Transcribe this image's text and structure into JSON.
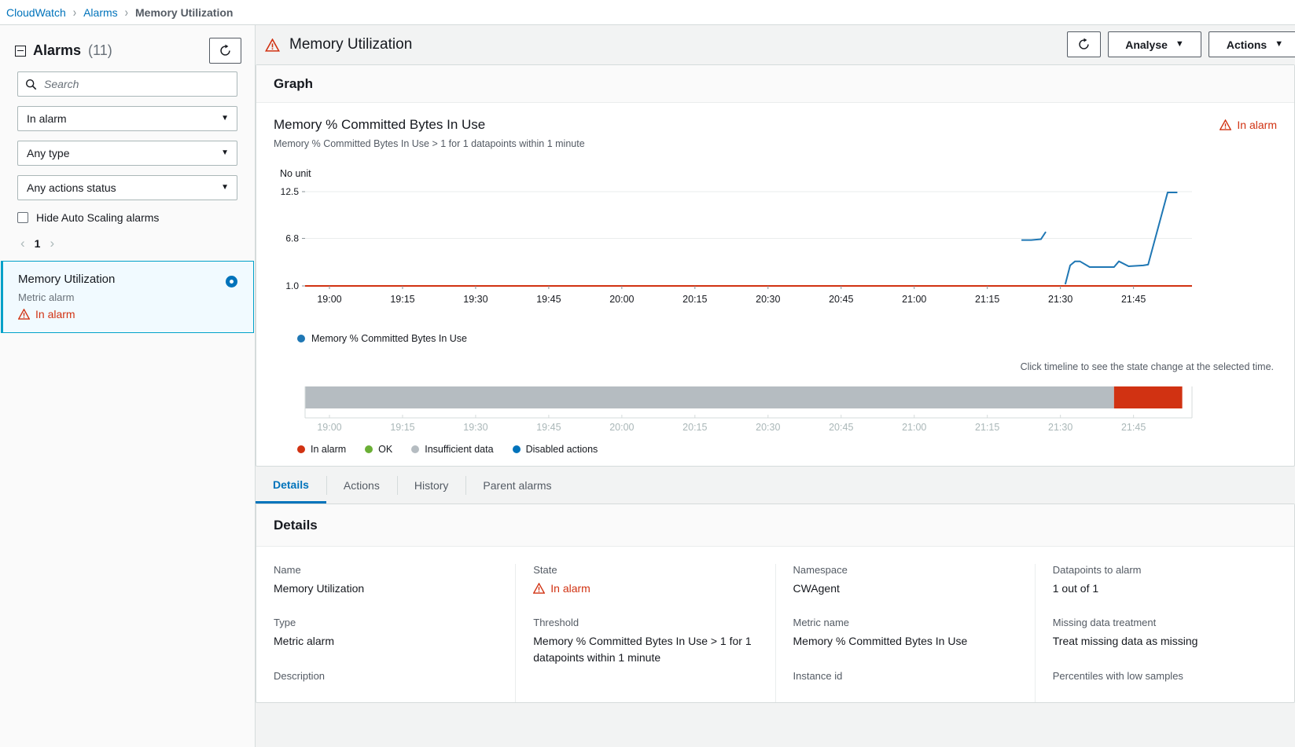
{
  "breadcrumb": {
    "items": [
      {
        "label": "CloudWatch",
        "link": true
      },
      {
        "label": "Alarms",
        "link": true
      },
      {
        "label": "Memory Utilization",
        "link": false
      }
    ],
    "separator": "›"
  },
  "sidebar": {
    "title": "Alarms",
    "count": "(11)",
    "refresh_icon": "refresh-icon",
    "search": {
      "placeholder": "Search",
      "value": "",
      "icon": "search-icon"
    },
    "filters": [
      {
        "name": "state-filter",
        "value": "In alarm"
      },
      {
        "name": "type-filter",
        "value": "Any type"
      },
      {
        "name": "actions-status-filter",
        "value": "Any actions status"
      }
    ],
    "checkbox": {
      "label": "Hide Auto Scaling alarms",
      "checked": false
    },
    "pagination": {
      "prev": "‹",
      "page": "1",
      "next": "›"
    },
    "alarms": [
      {
        "name": "Memory Utilization",
        "type": "Metric alarm",
        "state": "In alarm",
        "selected": true
      }
    ]
  },
  "header": {
    "title": "Memory Utilization",
    "state_icon": "alarm-warning-icon",
    "refresh_label": "",
    "analyse_label": "Analyse",
    "actions_label": "Actions",
    "caret": "▼"
  },
  "graph": {
    "card_title": "Graph",
    "title": "Memory % Committed Bytes In Use",
    "subtitle": "Memory % Committed Bytes In Use > 1 for 1 datapoints within 1 minute",
    "state": "In alarm",
    "unit_label": "No unit",
    "legend": [
      {
        "label": "Memory % Committed Bytes In Use",
        "color": "#1f77b4"
      }
    ],
    "timeline_hint": "Click timeline to see the state change at the selected time.",
    "timeline_legend": [
      {
        "label": "In alarm",
        "color": "#d13212"
      },
      {
        "label": "OK",
        "color": "#6aaf35"
      },
      {
        "label": "Insufficient data",
        "color": "#b5bcc1"
      },
      {
        "label": "Disabled actions",
        "color": "#0073bb"
      }
    ]
  },
  "chart_data": {
    "type": "line",
    "title": "Memory % Committed Bytes In Use",
    "xlabel": "",
    "ylabel": "No unit",
    "ylim": [
      1.0,
      12.5
    ],
    "yticks": [
      1.0,
      6.8,
      12.5
    ],
    "ytick_labels": [
      "1.0",
      "6.8",
      "12.5"
    ],
    "xticks": [
      "19:00",
      "19:15",
      "19:30",
      "19:45",
      "20:00",
      "20:15",
      "20:30",
      "20:45",
      "21:00",
      "21:15",
      "21:30",
      "21:45"
    ],
    "grid": true,
    "threshold": {
      "value": 1.0,
      "color": "#d13212",
      "label": "Memory % Committed Bytes In Use > 1"
    },
    "series": [
      {
        "name": "Memory % Committed Bytes In Use",
        "color": "#1f77b4",
        "segments": [
          {
            "x": [
              "21:22",
              "21:24",
              "21:26",
              "21:27"
            ],
            "y": [
              6.6,
              6.6,
              6.7,
              7.6
            ]
          },
          {
            "x": [
              "21:31",
              "21:32",
              "21:33",
              "21:34",
              "21:36",
              "21:40",
              "21:41",
              "21:42",
              "21:44",
              "21:47",
              "21:48",
              "21:52",
              "21:54"
            ],
            "y": [
              1.2,
              3.5,
              4.0,
              4.0,
              3.3,
              3.3,
              3.3,
              4.0,
              3.4,
              3.5,
              3.6,
              12.4,
              12.4
            ]
          }
        ]
      }
    ],
    "timeline": {
      "segments": [
        {
          "state": "Insufficient data",
          "color": "#b5bcc1",
          "from": "18:55",
          "to": "21:41"
        },
        {
          "state": "In alarm",
          "color": "#d13212",
          "from": "21:41",
          "to": "21:55"
        }
      ],
      "xticks": [
        "19:00",
        "19:15",
        "19:30",
        "19:45",
        "20:00",
        "20:15",
        "20:30",
        "20:45",
        "21:00",
        "21:15",
        "21:30",
        "21:45"
      ]
    }
  },
  "tabs": [
    {
      "label": "Details",
      "active": true
    },
    {
      "label": "Actions",
      "active": false
    },
    {
      "label": "History",
      "active": false
    },
    {
      "label": "Parent alarms",
      "active": false
    }
  ],
  "details": {
    "title": "Details",
    "columns": [
      {
        "fields": [
          {
            "label": "Name",
            "value": "Memory Utilization"
          },
          {
            "label": "Type",
            "value": "Metric alarm"
          },
          {
            "label": "Description",
            "value": ""
          }
        ]
      },
      {
        "fields": [
          {
            "label": "State",
            "value": "In alarm",
            "state": true
          },
          {
            "label": "Threshold",
            "value": "Memory % Committed Bytes In Use > 1 for 1 datapoints within 1 minute"
          }
        ]
      },
      {
        "fields": [
          {
            "label": "Namespace",
            "value": "CWAgent"
          },
          {
            "label": "Metric name",
            "value": "Memory % Committed Bytes In Use"
          },
          {
            "label": "Instance id",
            "value": ""
          }
        ]
      },
      {
        "fields": [
          {
            "label": "Datapoints to alarm",
            "value": "1 out of 1"
          },
          {
            "label": "Missing data treatment",
            "value": "Treat missing data as missing"
          },
          {
            "label": "Percentiles with low samples",
            "value": ""
          }
        ]
      }
    ]
  }
}
